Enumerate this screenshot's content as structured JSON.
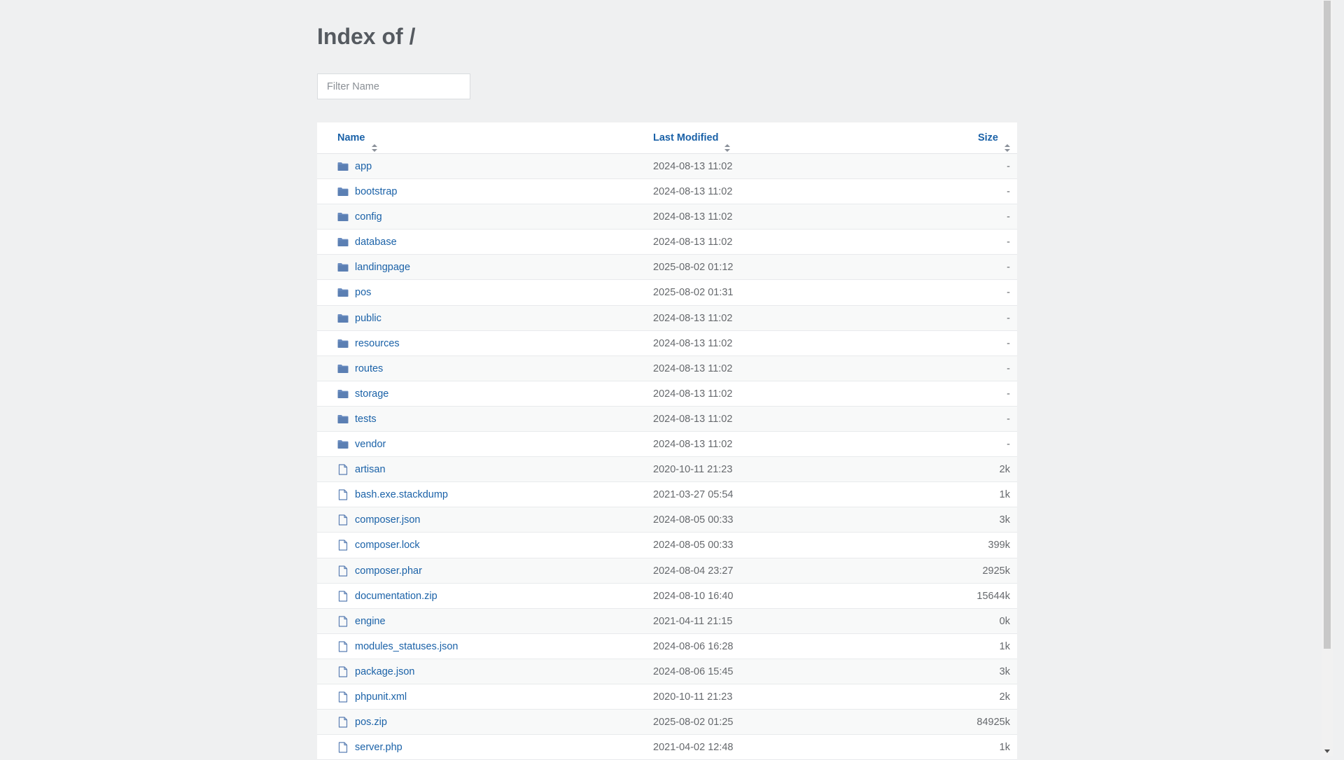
{
  "page": {
    "title": "Index of /",
    "filter_placeholder": "Filter Name"
  },
  "colors": {
    "background": "#eff0f1",
    "link": "#1b62a8",
    "muted_text": "#66696d",
    "folder_icon": "#5b7fb3",
    "file_icon": "#5b7fb3"
  },
  "table": {
    "headers": {
      "name": "Name",
      "modified": "Last Modified",
      "size": "Size"
    },
    "rows": [
      {
        "name": "app",
        "modified": "2024-08-13 11:02",
        "size": "-",
        "type": "folder"
      },
      {
        "name": "bootstrap",
        "modified": "2024-08-13 11:02",
        "size": "-",
        "type": "folder"
      },
      {
        "name": "config",
        "modified": "2024-08-13 11:02",
        "size": "-",
        "type": "folder"
      },
      {
        "name": "database",
        "modified": "2024-08-13 11:02",
        "size": "-",
        "type": "folder"
      },
      {
        "name": "landingpage",
        "modified": "2025-08-02 01:12",
        "size": "-",
        "type": "folder"
      },
      {
        "name": "pos",
        "modified": "2025-08-02 01:31",
        "size": "-",
        "type": "folder"
      },
      {
        "name": "public",
        "modified": "2024-08-13 11:02",
        "size": "-",
        "type": "folder"
      },
      {
        "name": "resources",
        "modified": "2024-08-13 11:02",
        "size": "-",
        "type": "folder"
      },
      {
        "name": "routes",
        "modified": "2024-08-13 11:02",
        "size": "-",
        "type": "folder"
      },
      {
        "name": "storage",
        "modified": "2024-08-13 11:02",
        "size": "-",
        "type": "folder"
      },
      {
        "name": "tests",
        "modified": "2024-08-13 11:02",
        "size": "-",
        "type": "folder"
      },
      {
        "name": "vendor",
        "modified": "2024-08-13 11:02",
        "size": "-",
        "type": "folder"
      },
      {
        "name": "artisan",
        "modified": "2020-10-11 21:23",
        "size": "2k",
        "type": "file"
      },
      {
        "name": "bash.exe.stackdump",
        "modified": "2021-03-27 05:54",
        "size": "1k",
        "type": "file"
      },
      {
        "name": "composer.json",
        "modified": "2024-08-05 00:33",
        "size": "3k",
        "type": "file"
      },
      {
        "name": "composer.lock",
        "modified": "2024-08-05 00:33",
        "size": "399k",
        "type": "file"
      },
      {
        "name": "composer.phar",
        "modified": "2024-08-04 23:27",
        "size": "2925k",
        "type": "file"
      },
      {
        "name": "documentation.zip",
        "modified": "2024-08-10 16:40",
        "size": "15644k",
        "type": "file"
      },
      {
        "name": "engine",
        "modified": "2021-04-11 21:15",
        "size": "0k",
        "type": "file"
      },
      {
        "name": "modules_statuses.json",
        "modified": "2024-08-06 16:28",
        "size": "1k",
        "type": "file"
      },
      {
        "name": "package.json",
        "modified": "2024-08-06 15:45",
        "size": "3k",
        "type": "file"
      },
      {
        "name": "phpunit.xml",
        "modified": "2020-10-11 21:23",
        "size": "2k",
        "type": "file"
      },
      {
        "name": "pos.zip",
        "modified": "2025-08-02 01:25",
        "size": "84925k",
        "type": "file"
      },
      {
        "name": "server.php",
        "modified": "2021-04-02 12:48",
        "size": "1k",
        "type": "file"
      }
    ]
  }
}
